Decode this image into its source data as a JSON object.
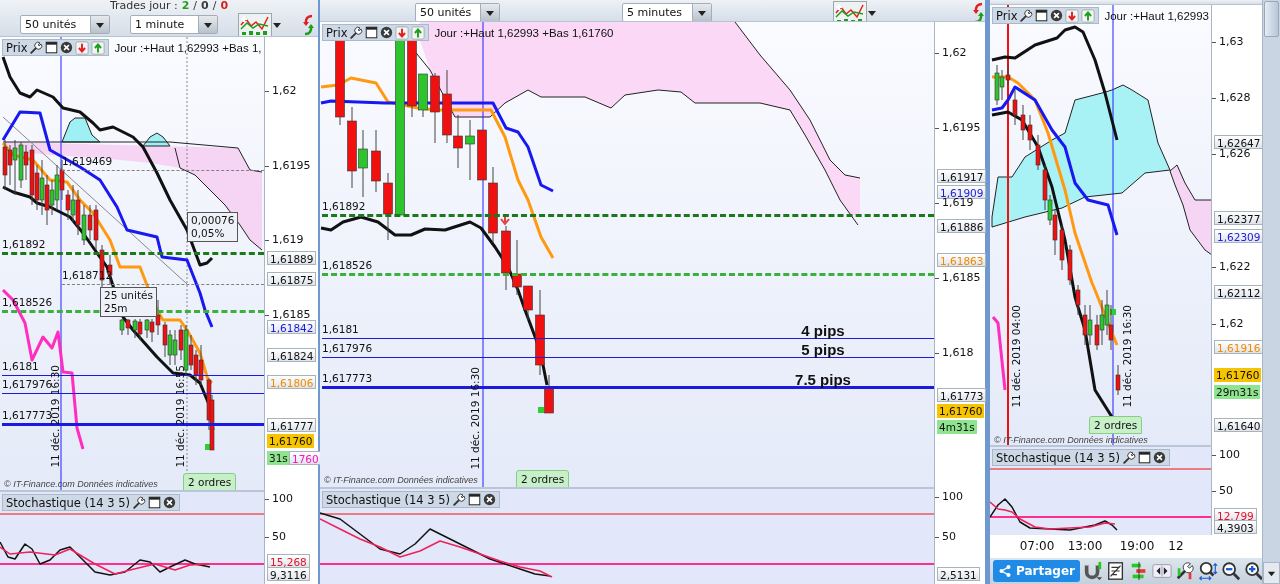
{
  "panels": [
    {
      "toolbar": {
        "trades": {
          "label": "Trades jour :",
          "separator": "/",
          "counts": [
            {
              "text": "2",
              "color": "#1f9e1f"
            },
            {
              "text": "0",
              "color": "#3a3a3a"
            },
            {
              "text": "0",
              "color": "#d42020"
            }
          ]
        },
        "units": "50 unités",
        "timeframe": "1 minute"
      },
      "price_pane": {
        "title": "Prix",
        "info": "Jour :+Haut 1,62993 +Bas 1,",
        "levels": [
          {
            "label": "1,619469",
            "color": "#808080"
          },
          {
            "label": "1,61892",
            "color": "#1a7a1a"
          },
          {
            "label": "1,618712",
            "color": "#808080"
          },
          {
            "label": "1,618526",
            "color": "#3cb03c"
          },
          {
            "label": "1,6181",
            "color": "#1a1ae0"
          },
          {
            "label": "1,617976",
            "color": "#1a1ae0"
          },
          {
            "label": "1,617773",
            "color": "#1a1ae0"
          }
        ],
        "overlays": [
          {
            "kind": "measure",
            "lines": [
              "0,00076",
              "0,05%"
            ]
          },
          {
            "kind": "measure",
            "lines": [
              "25 unités",
              "25m"
            ]
          },
          {
            "kind": "orders",
            "text": "2 ordres"
          }
        ],
        "date_labels": [
          "11 déc. 2019 16:30",
          "11 déc. 2019 16:55"
        ],
        "copyright": "© IT-Finance.com Données indicatives",
        "axis": [
          {
            "text": "1,62",
            "kind": "tick"
          },
          {
            "text": "1,6195",
            "kind": "tick"
          },
          {
            "text": "1,619",
            "kind": "tick"
          },
          {
            "text": "1,61889",
            "kind": "tag",
            "color": "#111111"
          },
          {
            "text": "1,61875",
            "kind": "tag",
            "color": "#111111"
          },
          {
            "text": "1,6185",
            "kind": "tick"
          },
          {
            "text": "1,61842",
            "kind": "tag",
            "color": "#1a1ae0"
          },
          {
            "text": "1,61824",
            "kind": "tag",
            "color": "#111111"
          },
          {
            "text": "1,61806",
            "kind": "tag",
            "color": "#f08a00"
          },
          {
            "text": "1,61777",
            "kind": "tag",
            "color": "#111111"
          },
          {
            "text": "1,61760",
            "kind": "price"
          },
          {
            "text": "31s",
            "kind": "timer"
          },
          {
            "text": "1760",
            "kind": "tag",
            "color": "#ff10c0"
          }
        ]
      },
      "stochastic_pane": {
        "title": "Stochastique (14 3 5)",
        "axis": [
          {
            "text": "100",
            "kind": "tick"
          },
          {
            "text": "50",
            "kind": "tick"
          },
          {
            "text": "15,268",
            "kind": "tag",
            "color": "#e8102a"
          },
          {
            "text": "9,3116",
            "kind": "tag",
            "color": "#111111"
          }
        ]
      }
    },
    {
      "toolbar": {
        "units": "50 unités",
        "timeframe": "5 minutes"
      },
      "price_pane": {
        "title": "Prix",
        "info": "Jour :+Haut 1,62993 +Bas 1,61760",
        "levels": [
          {
            "label": "1,61892",
            "color": "#1a7a1a"
          },
          {
            "label": "1,618526",
            "color": "#3cb03c"
          },
          {
            "label": "1,6181",
            "color": "#1a1ae0",
            "note": "4 pips"
          },
          {
            "label": "1,617976",
            "color": "#1a1ae0",
            "note": "5 pips"
          },
          {
            "label": "1,617773",
            "color": "#1a1ae0",
            "note": "7.5 pips"
          }
        ],
        "overlays": [
          {
            "kind": "orders",
            "text": "2 ordres"
          }
        ],
        "date_labels": [
          "11 déc. 2019 16:30"
        ],
        "copyright": "© IT-Finance.com Données indicatives",
        "axis": [
          {
            "text": "1,62",
            "kind": "tick"
          },
          {
            "text": "1,6195",
            "kind": "tick"
          },
          {
            "text": "1,61917",
            "kind": "tag",
            "color": "#111111"
          },
          {
            "text": "1,61909",
            "kind": "tag",
            "color": "#1a1ae0"
          },
          {
            "text": "1,619",
            "kind": "tick"
          },
          {
            "text": "1,61886",
            "kind": "tag",
            "color": "#111111"
          },
          {
            "text": "1,61863",
            "kind": "tag",
            "color": "#f08a00"
          },
          {
            "text": "1,6185",
            "kind": "tick"
          },
          {
            "text": "1,618",
            "kind": "tick"
          },
          {
            "text": "1,61773",
            "kind": "tag",
            "color": "#111111"
          },
          {
            "text": "1,61760",
            "kind": "price"
          },
          {
            "text": "4m31s",
            "kind": "timer"
          }
        ]
      },
      "stochastic_pane": {
        "title": "Stochastique (14 3 5)",
        "axis": [
          {
            "text": "100",
            "kind": "tick"
          },
          {
            "text": "50",
            "kind": "tick"
          },
          {
            "text": "2,5131",
            "kind": "tag",
            "color": "#111111"
          }
        ]
      }
    },
    {
      "price_pane": {
        "title": "Prix",
        "info": "Jour :+Haut 1,62993",
        "overlays": [
          {
            "kind": "orders",
            "text": "2 ordres"
          }
        ],
        "date_labels": [
          "11 déc. 2019 04:00",
          "11 déc. 2019 16:30"
        ],
        "copyright": "© IT-Finance.com Données indicatives",
        "axis": [
          {
            "text": "1,63",
            "kind": "tick"
          },
          {
            "text": "1,628",
            "kind": "tick"
          },
          {
            "text": "1,62647",
            "kind": "tag",
            "color": "#111111"
          },
          {
            "text": "1,626",
            "kind": "tick"
          },
          {
            "text": "1,62377",
            "kind": "tag",
            "color": "#111111"
          },
          {
            "text": "1,62309",
            "kind": "tag",
            "color": "#1a1ae0"
          },
          {
            "text": "1,622",
            "kind": "tick"
          },
          {
            "text": "1,62112",
            "kind": "tag",
            "color": "#111111"
          },
          {
            "text": "1,62",
            "kind": "tick"
          },
          {
            "text": "1,61916",
            "kind": "tag",
            "color": "#f08a00"
          },
          {
            "text": "1,61760",
            "kind": "price"
          },
          {
            "text": "29m31s",
            "kind": "timer"
          },
          {
            "text": "1,61640",
            "kind": "tag",
            "color": "#111111"
          }
        ]
      },
      "stochastic_pane": {
        "title": "Stochastique (14 3 5)",
        "axis": [
          {
            "text": "100",
            "kind": "tick"
          },
          {
            "text": "50",
            "kind": "tick"
          },
          {
            "text": "12,799",
            "kind": "tag",
            "color": "#e8102a"
          },
          {
            "text": "4,3903",
            "kind": "tag",
            "color": "#111111"
          }
        ]
      },
      "time_axis": [
        "07:00",
        "13:00",
        "19:00",
        "12"
      ],
      "bottom_toolbar": {
        "share_button": "Partager"
      }
    }
  ]
}
